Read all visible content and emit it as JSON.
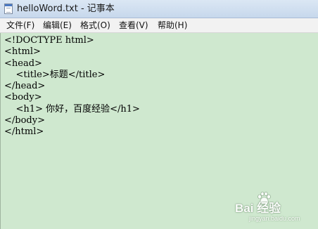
{
  "window": {
    "title": "helloWord.txt - 记事本"
  },
  "menubar": {
    "items": [
      {
        "label": "文件(F)"
      },
      {
        "label": "编辑(E)"
      },
      {
        "label": "格式(O)"
      },
      {
        "label": "查看(V)"
      },
      {
        "label": "帮助(H)"
      }
    ]
  },
  "editor": {
    "lines": [
      "<!DOCTYPE html>",
      "<html>",
      "<head>",
      "    <title>标题</title>",
      "</head>",
      "<body>",
      "    <h1> 你好，百度经验</h1>",
      "</body>",
      "</html>"
    ]
  },
  "watermark": {
    "main": "Bai 经验",
    "sub": "jingyan.baidu.com",
    "icon": "baidu-paw-icon"
  }
}
